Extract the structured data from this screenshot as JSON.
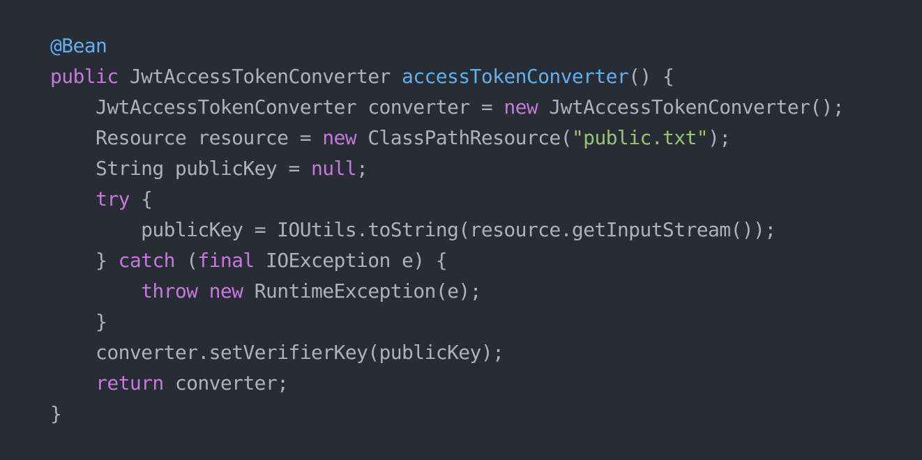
{
  "editor": {
    "language": "Java",
    "theme_colors": {
      "background": "#282c34",
      "plain": "#abb2bf",
      "keyword": "#c678dd",
      "function": "#61afef",
      "string": "#98c379",
      "annotation": "#61afef"
    },
    "lines": [
      {
        "tokens": [
          {
            "t": "@Bean",
            "k": "ann"
          }
        ]
      },
      {
        "tokens": [
          {
            "t": "public",
            "k": "kw"
          },
          {
            "t": " JwtAccessTokenConverter ",
            "k": "plain"
          },
          {
            "t": "accessTokenConverter",
            "k": "fn"
          },
          {
            "t": "() {",
            "k": "plain"
          }
        ]
      },
      {
        "tokens": [
          {
            "t": "    JwtAccessTokenConverter converter = ",
            "k": "plain"
          },
          {
            "t": "new",
            "k": "kw"
          },
          {
            "t": " JwtAccessTokenConverter();",
            "k": "plain"
          }
        ]
      },
      {
        "tokens": [
          {
            "t": "    Resource resource = ",
            "k": "plain"
          },
          {
            "t": "new",
            "k": "kw"
          },
          {
            "t": " ClassPathResource(",
            "k": "plain"
          },
          {
            "t": "\"public.txt\"",
            "k": "str"
          },
          {
            "t": ");",
            "k": "plain"
          }
        ]
      },
      {
        "tokens": [
          {
            "t": "    String publicKey = ",
            "k": "plain"
          },
          {
            "t": "null",
            "k": "kw"
          },
          {
            "t": ";",
            "k": "plain"
          }
        ]
      },
      {
        "tokens": [
          {
            "t": "    ",
            "k": "plain"
          },
          {
            "t": "try",
            "k": "kw"
          },
          {
            "t": " {",
            "k": "plain"
          }
        ]
      },
      {
        "tokens": [
          {
            "t": "        publicKey = IOUtils.toString(resource.getInputStream());",
            "k": "plain"
          }
        ]
      },
      {
        "tokens": [
          {
            "t": "    } ",
            "k": "plain"
          },
          {
            "t": "catch",
            "k": "kw"
          },
          {
            "t": " (",
            "k": "plain"
          },
          {
            "t": "final",
            "k": "kw"
          },
          {
            "t": " IOException e) {",
            "k": "plain"
          }
        ]
      },
      {
        "tokens": [
          {
            "t": "        ",
            "k": "plain"
          },
          {
            "t": "throw",
            "k": "kw"
          },
          {
            "t": " ",
            "k": "plain"
          },
          {
            "t": "new",
            "k": "kw"
          },
          {
            "t": " RuntimeException(e);",
            "k": "plain"
          }
        ]
      },
      {
        "tokens": [
          {
            "t": "    }",
            "k": "plain"
          }
        ]
      },
      {
        "tokens": [
          {
            "t": "    converter.setVerifierKey(publicKey);",
            "k": "plain"
          }
        ]
      },
      {
        "tokens": [
          {
            "t": "    ",
            "k": "plain"
          },
          {
            "t": "return",
            "k": "kw"
          },
          {
            "t": " converter;",
            "k": "plain"
          }
        ]
      },
      {
        "tokens": [
          {
            "t": "}",
            "k": "plain"
          }
        ]
      }
    ]
  }
}
